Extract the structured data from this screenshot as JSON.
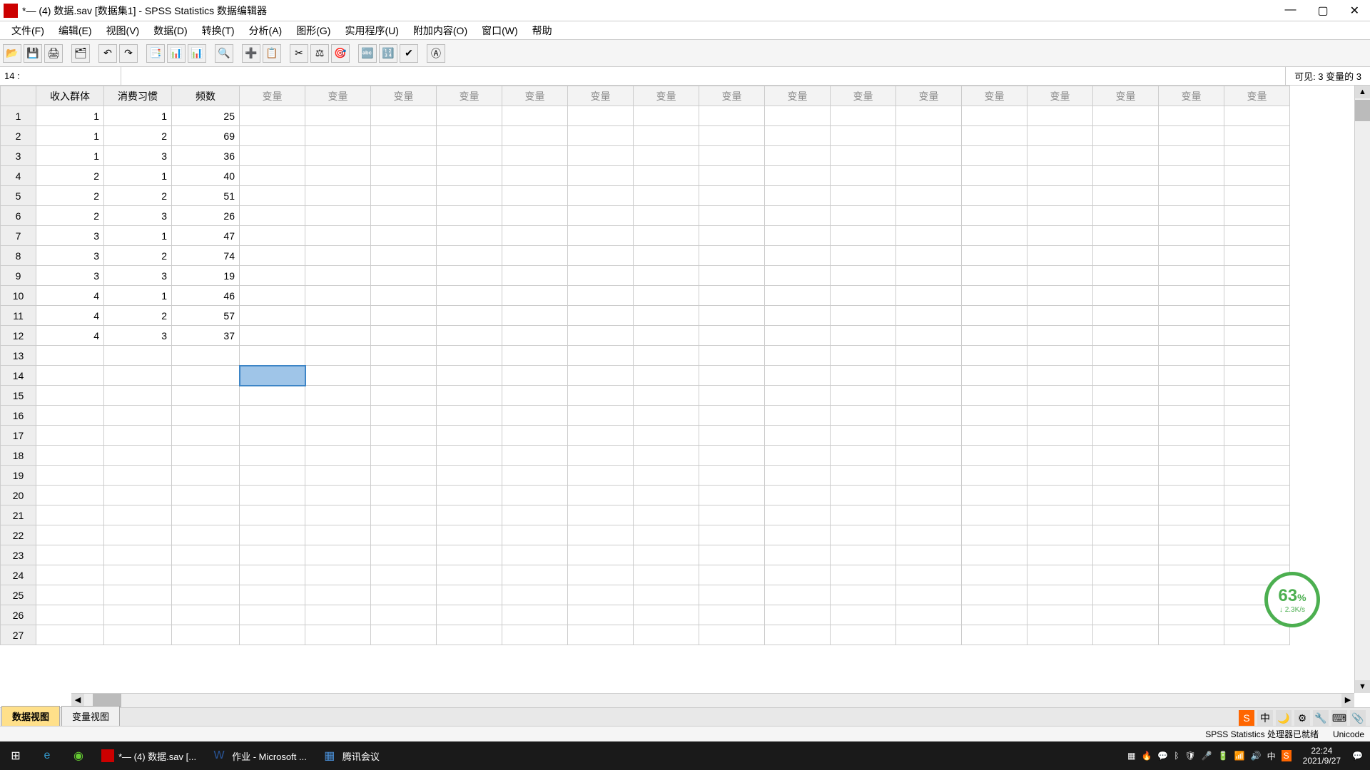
{
  "window": {
    "title": "*— (4) 数据.sav [数据集1] - SPSS Statistics 数据编辑器"
  },
  "menu": {
    "file": "文件(F)",
    "edit": "编辑(E)",
    "view": "视图(V)",
    "data": "数据(D)",
    "transform": "转换(T)",
    "analyze": "分析(A)",
    "graphs": "图形(G)",
    "utilities": "实用程序(U)",
    "addons": "附加内容(O)",
    "window": "窗口(W)",
    "help": "帮助"
  },
  "cellref": {
    "label": "14 :",
    "visible_info": "可见: 3 变量的 3"
  },
  "columns": {
    "c1": "收入群体",
    "c2": "消费习惯",
    "c3": "频数",
    "empty": "变量"
  },
  "rows": [
    {
      "n": "1",
      "a": "1",
      "b": "1",
      "c": "25"
    },
    {
      "n": "2",
      "a": "1",
      "b": "2",
      "c": "69"
    },
    {
      "n": "3",
      "a": "1",
      "b": "3",
      "c": "36"
    },
    {
      "n": "4",
      "a": "2",
      "b": "1",
      "c": "40"
    },
    {
      "n": "5",
      "a": "2",
      "b": "2",
      "c": "51"
    },
    {
      "n": "6",
      "a": "2",
      "b": "3",
      "c": "26"
    },
    {
      "n": "7",
      "a": "3",
      "b": "1",
      "c": "47"
    },
    {
      "n": "8",
      "a": "3",
      "b": "2",
      "c": "74"
    },
    {
      "n": "9",
      "a": "3",
      "b": "3",
      "c": "19"
    },
    {
      "n": "10",
      "a": "4",
      "b": "1",
      "c": "46"
    },
    {
      "n": "11",
      "a": "4",
      "b": "2",
      "c": "57"
    },
    {
      "n": "12",
      "a": "4",
      "b": "3",
      "c": "37"
    }
  ],
  "empty_row_start": 13,
  "empty_row_end": 27,
  "selected_cell_row": 14,
  "view_tabs": {
    "data_view": "数据视图",
    "variable_view": "变量视图"
  },
  "status": {
    "right": "SPSS Statistics 处理器已就绪",
    "right2": "Unicode"
  },
  "taskbar": {
    "app1": "*— (4) 数据.sav [...",
    "app2": "作业 - Microsoft ...",
    "app3": "腾讯会议",
    "clock_time": "22:24",
    "clock_date": "2021/9/27",
    "ime": "中"
  },
  "perf": {
    "main": "63",
    "unit": "%",
    "sub": "↓ 2.3K/s"
  },
  "icons": {
    "open": "📂",
    "save": "💾",
    "print": "🖨",
    "recall": "🗂",
    "undo": "↶",
    "redo": "↷",
    "goto": "📑",
    "vars": "📊",
    "find": "🔍",
    "insert_case": "➕",
    "insert_var": "📋",
    "split": "✂",
    "weight": "⚖",
    "select": "🎯",
    "value": "🔤",
    "usevar": "🔢",
    "spell": "✔",
    "abc": "Ⓐ"
  }
}
